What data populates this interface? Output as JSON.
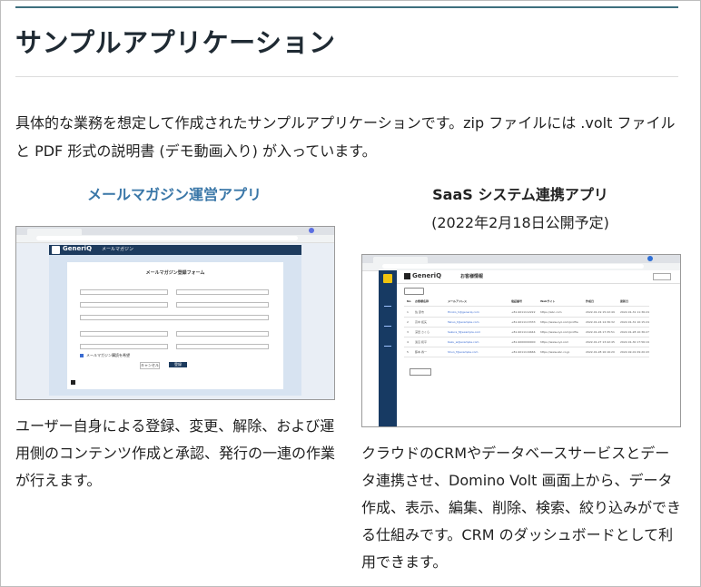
{
  "page": {
    "title": "サンプルアプリケーション",
    "intro": "具体的な業務を想定して作成されたサンプルアプリケーションです。zip ファイルには .volt ファイルと PDF 形式の説明書 (デモ動画入り) が入っています。"
  },
  "apps": [
    {
      "title": "メールマガジン運営アプリ",
      "description": "ユーザー自身による登録、変更、解除、および運用側のコンテンツ作成と承認、発行の一連の作業が行えます。",
      "shot": {
        "brand": "GeneriQ",
        "app_name": "メールマガジン",
        "form_title": "メールマガジン登録フォーム",
        "cancel_label": "キャンセル",
        "submit_label": "登録",
        "checkbox_label": "メールマガジン購読を希望"
      }
    },
    {
      "title": "SaaS システム連携アプリ",
      "subtitle": "(2022年2月18日公開予定)",
      "description": "クラウドのCRMやデータベースサービスとデータ連携させ、Domino Volt 画面上から、データ作成、表示、編集、削除、検索、絞り込みができる仕組みです。CRM のダッシュボードとして利用できます。",
      "shot": {
        "brand": "GeneriQ",
        "screen_title": "お客様情報",
        "columns": [
          "No",
          "お客様名称",
          "メールアドレス",
          "電話番号",
          "Webサイト",
          "作成日",
          "更新日"
        ],
        "rows": [
          [
            "1",
            "佐 彦市",
            "Hiroko_h@generiq.com",
            "+81-9011112222",
            "https://abc.com",
            "2022-01-19 15:22:49",
            "2022-01-31 11:36:24"
          ],
          [
            "2",
            "高中 拓矢",
            "Takuo_t@example.com",
            "+81-9011113333",
            "https://www.xyz.com/profile",
            "2022-01-24 14:36:32",
            "2022-01-31 10:15:24"
          ],
          [
            "3",
            "深田 さくら",
            "Sakura_f@example.com",
            "+81-9011114444",
            "https://www.xyz.com/profile",
            "2022-01-26 17:35:51",
            "2022-01-28 10:36:27"
          ],
          [
            "4",
            "渡辺 和平",
            "Kazu_w@example.com",
            "+81-9000000000",
            "https://www.xyz.com",
            "2022-01-27 13:42:45",
            "2022-01-30 17:56:19"
          ],
          [
            "5",
            "藤本 春一",
            "Shun_f@example.com",
            "+81-9011116666",
            "https://www.abc.co.jp",
            "2022-01-28 16:16:20",
            "2022-02-01 09:20:43"
          ]
        ]
      }
    }
  ],
  "colors": {
    "accent_line": "#3d6f7e",
    "link_title": "#3a77a8",
    "app_header": "#1d3b5e",
    "sidebar": "#173a63"
  }
}
